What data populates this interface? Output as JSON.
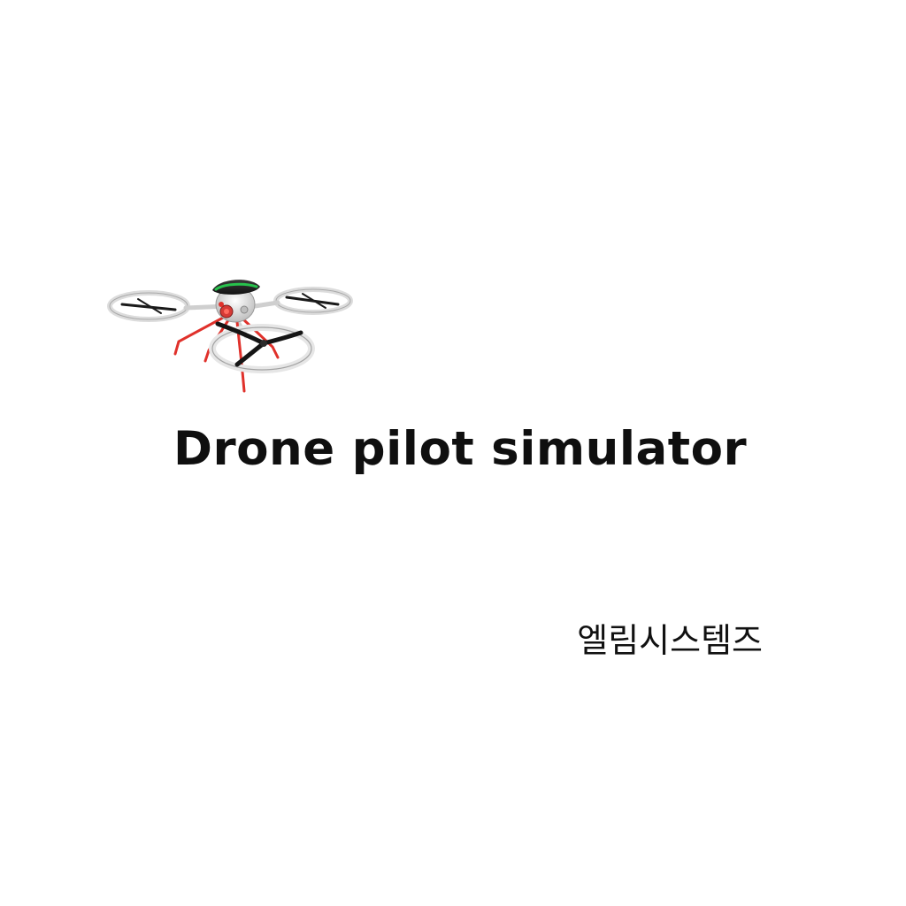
{
  "splash": {
    "title": "Drone pilot simulator",
    "company": "엘림시스템즈"
  },
  "logo": {
    "icon": "drone-icon",
    "colors": {
      "frame": "#e8e8e8",
      "propeller": "#1a1a1a",
      "landing_gear": "#e0312b",
      "canopy_glow": "#27c24c"
    }
  }
}
